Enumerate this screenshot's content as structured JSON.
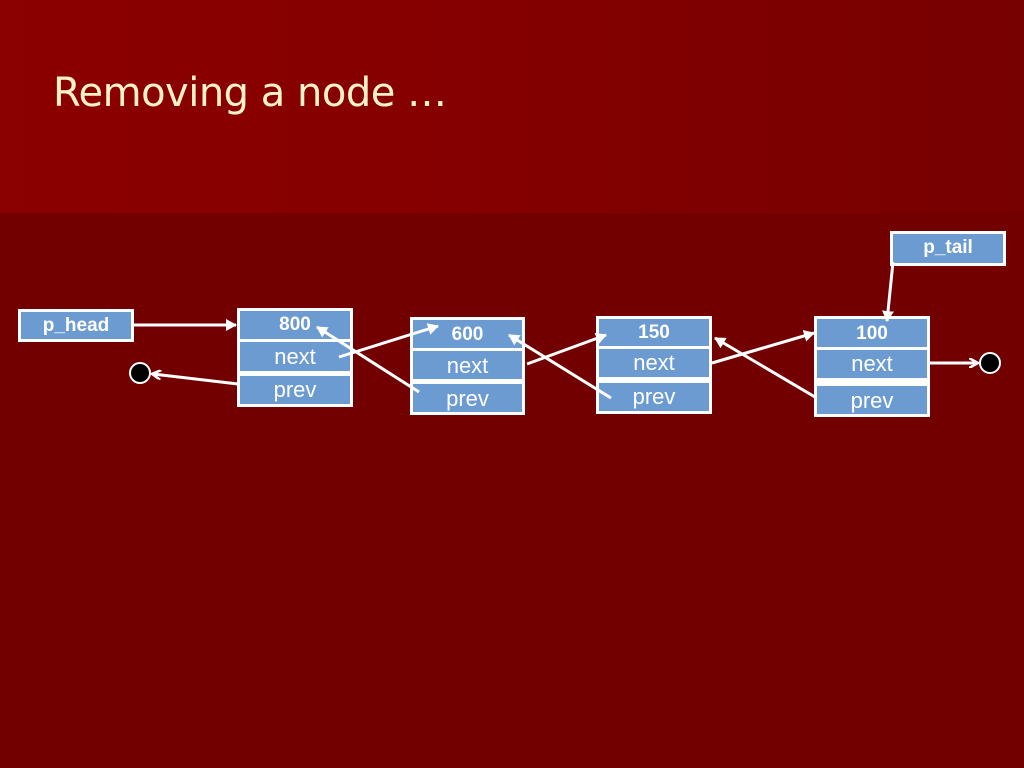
{
  "slide": {
    "title": "Removing a node …"
  },
  "pointers": {
    "head": {
      "label": "p_head"
    },
    "tail": {
      "label": "p_tail"
    }
  },
  "nodes": [
    {
      "value": "800",
      "next_label": "next",
      "prev_label": "prev"
    },
    {
      "value": "600",
      "next_label": "next",
      "prev_label": "prev"
    },
    {
      "value": "150",
      "next_label": "next",
      "prev_label": "prev"
    },
    {
      "value": "100",
      "next_label": "next",
      "prev_label": "prev"
    }
  ],
  "links": [
    {
      "from": "p_head",
      "to": "800",
      "kind": "pointer"
    },
    {
      "from": "800.prev",
      "to": "null",
      "kind": "prev"
    },
    {
      "from": "800.next",
      "to": "600",
      "kind": "next"
    },
    {
      "from": "600.prev",
      "to": "800",
      "kind": "prev"
    },
    {
      "from": "600.next",
      "to": "150",
      "kind": "next"
    },
    {
      "from": "150.prev",
      "to": "600",
      "kind": "prev"
    },
    {
      "from": "150.next",
      "to": "100",
      "kind": "next"
    },
    {
      "from": "100.prev",
      "to": "150",
      "kind": "prev"
    },
    {
      "from": "100.next",
      "to": "null",
      "kind": "next"
    },
    {
      "from": "p_tail",
      "to": "100",
      "kind": "pointer"
    }
  ],
  "colors": {
    "background": "#730000",
    "header": "#8b0000",
    "title_text": "#fff2c6",
    "box_fill": "#6b9bd1",
    "box_border": "#ffffff",
    "arrow": "#ffffff",
    "null_marker": "#000000"
  }
}
